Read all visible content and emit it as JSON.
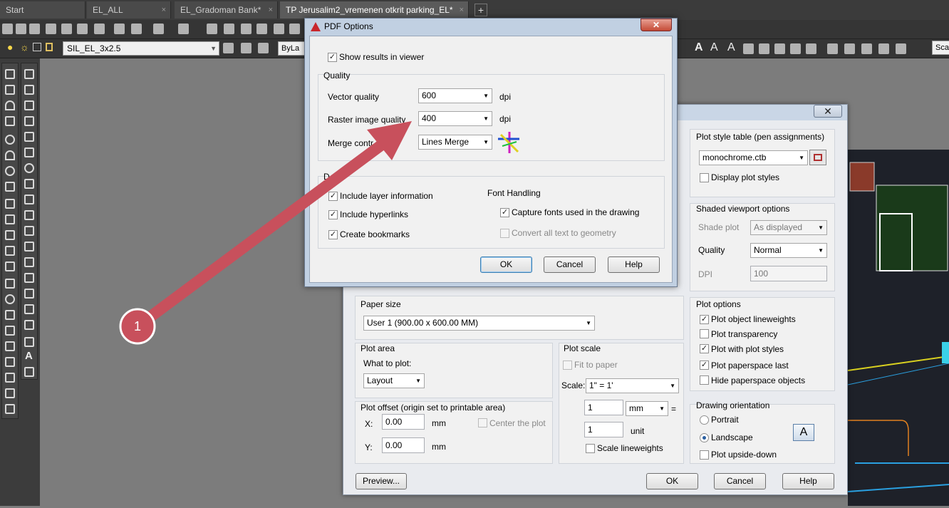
{
  "tabs": [
    {
      "label": "Start"
    },
    {
      "label": "EL_ALL"
    },
    {
      "label": "EL_Gradoman Bank*"
    },
    {
      "label": "TP Jerusalim2_vremenen otkrit parking_EL*"
    }
  ],
  "tab_close": "×",
  "add_tab": "+",
  "toolbar": {
    "layer_name": "SIL_EL_3x2.5",
    "bylayer": "ByLa",
    "scale_label": "Scal"
  },
  "pdf_dialog": {
    "title": "PDF Options",
    "close": "✕",
    "show_results_label": "Show results in viewer",
    "quality_title": "Quality",
    "vector_quality_label": "Vector quality",
    "vector_quality_value": "600",
    "raster_quality_label": "Raster image quality",
    "raster_quality_value": "400",
    "dpi_unit": "dpi",
    "merge_control_label": "Merge contr",
    "merge_control_value": "Lines Merge",
    "data_title_partial": "D",
    "include_layer_label": "Include layer information",
    "include_hyperlinks_label": "Include hyperlinks",
    "create_bookmarks_label": "Create bookmarks",
    "font_handling_title": "Font Handling",
    "capture_fonts_label": "Capture fonts used in the drawing",
    "convert_text_label": "Convert all text to geometry",
    "ok": "OK",
    "cancel": "Cancel",
    "help": "Help"
  },
  "plot_dialog": {
    "close": "✕",
    "plot_style_title": "Plot style table (pen assignments)",
    "plot_style_value": "monochrome.ctb",
    "display_plot_styles": "Display plot styles",
    "shaded_title": "Shaded viewport options",
    "shade_plot_label": "Shade plot",
    "shade_plot_value": "As displayed",
    "quality_label": "Quality",
    "quality_value": "Normal",
    "dpi_label": "DPI",
    "dpi_value": "100",
    "paper_size_title": "Paper size",
    "paper_size_value": "User 1 (900.00 x 600.00 MM)",
    "plot_area_title": "Plot area",
    "what_to_plot_label": "What to plot:",
    "what_to_plot_value": "Layout",
    "plot_scale_title": "Plot scale",
    "fit_to_paper": "Fit to paper",
    "scale_label": "Scale:",
    "scale_value": "1\" = 1'",
    "scale_num": "1",
    "scale_unit_value": "mm",
    "equals": "=",
    "scale_den": "1",
    "unit_label": "unit",
    "scale_lineweights": "Scale lineweights",
    "offset_title": "Plot offset (origin set to printable area)",
    "x_label": "X:",
    "x_value": "0.00",
    "y_label": "Y:",
    "y_value": "0.00",
    "mm": "mm",
    "center_plot": "Center the plot",
    "plot_options_title": "Plot options",
    "opt_lineweights": "Plot object lineweights",
    "opt_transparency": "Plot transparency",
    "opt_styles": "Plot with plot styles",
    "opt_paperspace_last": "Plot paperspace last",
    "opt_hide_paperspace": "Hide paperspace objects",
    "orientation_title": "Drawing orientation",
    "portrait": "Portrait",
    "landscape": "Landscape",
    "upside_down": "Plot upside-down",
    "orientation_icon_letter": "A",
    "preview": "Preview...",
    "ok": "OK",
    "cancel": "Cancel",
    "help": "Help"
  },
  "annotation": {
    "number": "1",
    "color": "#c8505c"
  },
  "checkmark": "✓"
}
